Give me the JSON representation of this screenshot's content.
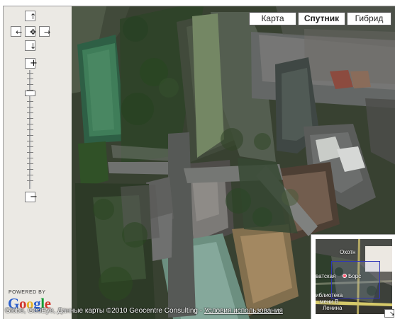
{
  "navigation": {
    "up_icon": "↑",
    "left_icon": "←",
    "center_icon": "✥",
    "right_icon": "→",
    "down_icon": "↓"
  },
  "zoom": {
    "plus": "+",
    "minus": "−",
    "level_fraction": 0.82
  },
  "map_type": {
    "map": "Карта",
    "satellite": "Спутник",
    "hybrid": "Гибрид",
    "selected": "Спутник"
  },
  "branding": {
    "powered_by": "POWERED BY",
    "logo_letters": [
      "G",
      "o",
      "o",
      "g",
      "l",
      "e"
    ]
  },
  "footer": {
    "copyright_prefix": "Globe, GeoEye, Данные карты ©2010 Geocentre Consulting - ",
    "terms": "Условия использования"
  },
  "overview_map": {
    "label_top": "Охотн",
    "label_left": "ватская",
    "label_mid": "Борс",
    "label_lib": "иблиотека",
    "label_lenin_1": "мени В",
    "label_lenin_2": "Ленина",
    "toggle_icon": "↘"
  },
  "icons": {
    "nav_up": "arrow-up-icon",
    "nav_left": "arrow-left-icon",
    "nav_center": "move-center-icon",
    "nav_right": "arrow-right-icon",
    "nav_down": "arrow-down-icon",
    "overview_toggle": "overview-collapse-icon"
  },
  "colors": {
    "active_map_type": "#000000",
    "overview_box": "#2f36b8",
    "terms_link": "#ffffff"
  }
}
